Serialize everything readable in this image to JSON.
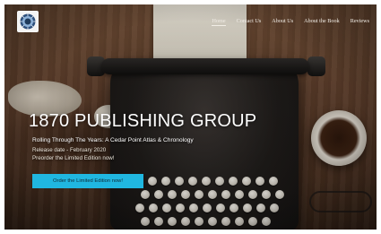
{
  "header": {
    "logo_icon": "seal-logo-icon",
    "nav": [
      {
        "label": "Home",
        "active": true
      },
      {
        "label": "Contact Us",
        "active": false
      },
      {
        "label": "About Us",
        "active": false
      },
      {
        "label": "About the Book",
        "active": false
      },
      {
        "label": "Reviews",
        "active": false
      }
    ]
  },
  "hero": {
    "title": "1870 PUBLISHING GROUP",
    "subtitle": "Rolling Through The Years: A Cedar Point Atlas & Chronology",
    "release": "Release date - February 2020",
    "preorder": "Preorder the Limited Edition now!",
    "cta_label": "Order the Limited Edition now!"
  },
  "colors": {
    "cta_background": "#20b7e0",
    "nav_text": "#f1ede6"
  }
}
